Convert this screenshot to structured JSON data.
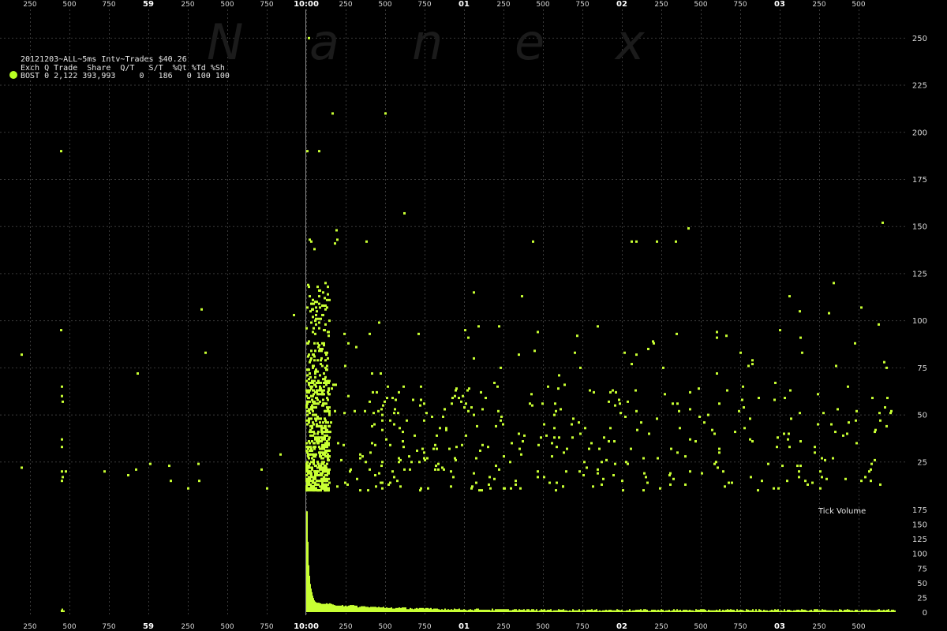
{
  "watermark": [
    "N",
    "a",
    "n",
    "e",
    "x"
  ],
  "header": {
    "line1": "20121203~ALL~5ms Intv~Trades $40.26",
    "line2": "Exch Q Trade  Share  Q/T   S/T  %Qt %Td %Sh",
    "line3": "BOST 0 2,122 393,993     0   186   0 100 100"
  },
  "colors": {
    "background": "#000000",
    "points": "#c8ff33",
    "grid": "#3a3a3a",
    "cursor": "#8a8a8a",
    "legend_dot": "#b8ff22"
  },
  "x_axis": {
    "labels": [
      "250",
      "500",
      "750",
      "59",
      "250",
      "500",
      "750",
      "10:00",
      "250",
      "500",
      "750",
      "01",
      "250",
      "500",
      "750",
      "02",
      "250",
      "500",
      "750",
      "03",
      "250",
      "500"
    ],
    "bold": [
      "59",
      "10:00",
      "01",
      "02",
      "03"
    ]
  },
  "chart_data": [
    {
      "type": "scatter",
      "title": "",
      "ylabel": "",
      "ylim": [
        0,
        265
      ],
      "yticks": [
        25,
        50,
        75,
        100,
        125,
        150,
        175,
        200,
        225,
        250
      ],
      "series": [
        {
          "values": []
        }
      ]
    },
    {
      "type": "bar",
      "title": "Tick Volume",
      "ylim": [
        0,
        175
      ],
      "yticks": [
        0,
        25,
        50,
        75,
        100,
        125,
        150,
        175
      ],
      "series": [
        {
          "values": []
        }
      ]
    }
  ]
}
